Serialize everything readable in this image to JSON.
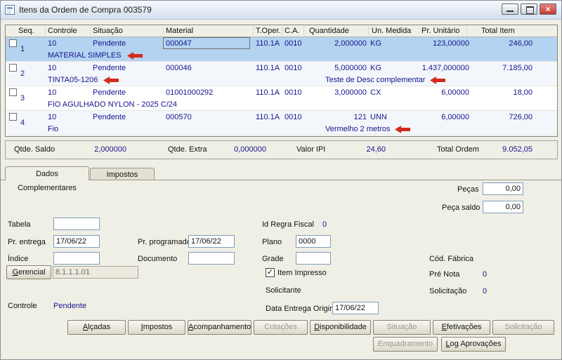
{
  "window": {
    "title": "Itens da Ordem de Compra 003579"
  },
  "icons": {
    "window_icon": "form-icon",
    "minimize": "minimize-icon",
    "maximize": "maximize-icon",
    "close_glyph": "×",
    "check_glyph": "✓",
    "annotation_arrow": "red-left-arrow"
  },
  "colors": {
    "value_text": "#14148c",
    "selected_row": "#b3d3f0",
    "annotation_arrow": "#d42a1e",
    "panel_background": "#f0efe6"
  },
  "grid": {
    "columns": [
      "Seq.",
      "Controle",
      "Situação",
      "Material",
      "T.Oper.",
      "C.A.",
      "Quantidade",
      "Un. Medida",
      "Pr. Unitário",
      "Total Item"
    ],
    "rows": [
      {
        "seq": "1",
        "controle": "10",
        "situacao": "Pendente",
        "material": "000047",
        "t_oper": "110.1A",
        "ca": "0010",
        "quantidade": "2,000000",
        "un_medida": "KG",
        "pr_unitario": "123,00000",
        "total_item": "246,00",
        "descricao": "MATERIAL SIMPLES",
        "observacao": ""
      },
      {
        "seq": "2",
        "controle": "10",
        "situacao": "Pendente",
        "material": "000046",
        "t_oper": "110.1A",
        "ca": "0010",
        "quantidade": "5,000000",
        "un_medida": "KG",
        "pr_unitario": "1.437,000000",
        "total_item": "7.185,00",
        "descricao": "TINTA05-1206",
        "observacao": "Teste de Desc complementar"
      },
      {
        "seq": "3",
        "controle": "10",
        "situacao": "Pendente",
        "material": "01001000292",
        "t_oper": "110.1A",
        "ca": "0010",
        "quantidade": "3,000000",
        "un_medida": "CX",
        "pr_unitario": "6,00000",
        "total_item": "18,00",
        "descricao": "FIO AGULHADO NYLON - 2025 C/24",
        "observacao": ""
      },
      {
        "seq": "4",
        "controle": "10",
        "situacao": "Pendente",
        "material": "000570",
        "t_oper": "110.1A",
        "ca": "0010",
        "quantidade": "121",
        "un_medida": "UNN",
        "pr_unitario": "6,00000",
        "total_item": "726,00",
        "descricao": "Fio",
        "observacao": "Vermelho 2 metros"
      }
    ]
  },
  "summary": {
    "qtde_saldo_label": "Qtde. Saldo",
    "qtde_saldo_value": "2,000000",
    "qtde_extra_label": "Qtde. Extra",
    "qtde_extra_value": "0,000000",
    "valor_ipi_label": "Valor IPI",
    "valor_ipi_value": "24,60",
    "total_ordem_label": "Total Ordem",
    "total_ordem_value": "9.052,05"
  },
  "tabs": {
    "dados_complementares": "Dados Complementares",
    "impostos": "Impostos"
  },
  "form": {
    "pecas_label": "Peças",
    "pecas_value": "0,00",
    "peca_saldo_label": "Peça saldo",
    "peca_saldo_value": "0,00",
    "tabela_label": "Tabela",
    "tabela_value": "",
    "id_regra_fiscal_label": "Id Regra Fiscal",
    "id_regra_fiscal_value": "0",
    "pr_entrega_label": "Pr. entrega",
    "pr_entrega_value": "17/06/22",
    "pr_programado_label": "Pr. programado",
    "pr_programado_value": "17/06/22",
    "plano_label": "Plano",
    "plano_value": "0000",
    "indice_label": "Índice",
    "indice_value": "",
    "documento_label": "Documento",
    "documento_value": "",
    "grade_label": "Grade",
    "grade_value": "",
    "cod_fabrica_label": "Cód. Fábrica",
    "gerencial_label": "Gerencial",
    "gerencial_value": "8.1.1.1.01",
    "item_impresso_label": "Item Impresso",
    "pre_nota_label": "Pré Nota",
    "pre_nota_value": "0",
    "solicitante_label": "Solicitante",
    "solicitacao_label": "Solicitação",
    "solicitacao_value": "0",
    "controle_label": "Controle",
    "controle_value": "Pendente",
    "data_entrega_original_label": "Data Entrega Original",
    "data_entrega_original_value": "17/06/22"
  },
  "actions": {
    "alcadas": "Alçadas",
    "impostos": "Impostos",
    "acompanhamento": "Acompanhamento",
    "cotacoes": "Cotações",
    "disponibilidade": "Disponibilidade",
    "situacao": "Situação",
    "efetivacoes": "Efetivações",
    "solicitacao": "Solicitação",
    "enquadramento": "Enquadramento",
    "log_aprovacoes": "Log Aprovações"
  }
}
